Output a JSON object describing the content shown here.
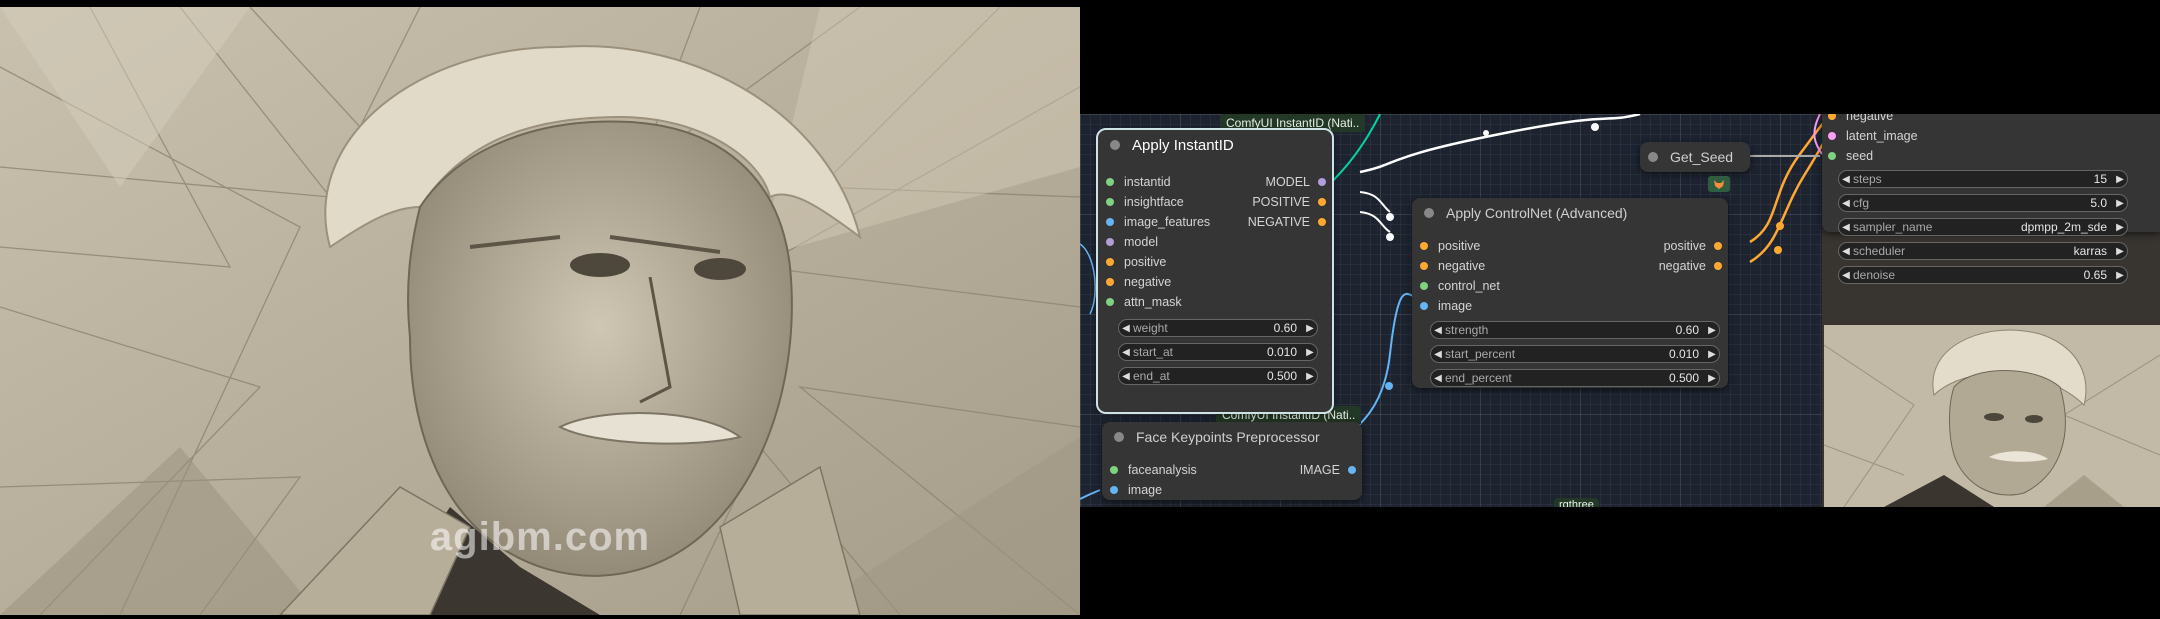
{
  "left_image": {
    "watermark": "agibm.com"
  },
  "canvas": {
    "group_tags": {
      "instantid_top": "ComfyUI InstantID (Nati..",
      "instantid_bottom": "ComfyUI InstantID (Nati..",
      "rgthree": "rgthree"
    },
    "apply_instantid": {
      "title": "Apply InstantID",
      "inputs": [
        "instantid",
        "insightface",
        "image_features",
        "model",
        "positive",
        "negative",
        "attn_mask"
      ],
      "outputs": [
        "MODEL",
        "POSITIVE",
        "NEGATIVE"
      ],
      "widgets": [
        {
          "label": "weight",
          "value": "0.60"
        },
        {
          "label": "start_at",
          "value": "0.010"
        },
        {
          "label": "end_at",
          "value": "0.500"
        }
      ]
    },
    "face_keypoints": {
      "title": "Face Keypoints Preprocessor",
      "inputs": [
        "faceanalysis",
        "image"
      ],
      "outputs": [
        "IMAGE"
      ]
    },
    "apply_controlnet": {
      "title": "Apply ControlNet (Advanced)",
      "inputs": [
        "positive",
        "negative",
        "control_net",
        "image"
      ],
      "outputs": [
        "positive",
        "negative"
      ],
      "widgets": [
        {
          "label": "strength",
          "value": "0.60"
        },
        {
          "label": "start_percent",
          "value": "0.010"
        },
        {
          "label": "end_percent",
          "value": "0.500"
        }
      ]
    },
    "get_seed": {
      "title": "Get_Seed"
    },
    "ksampler": {
      "inputs": [
        "negative",
        "latent_image",
        "seed"
      ],
      "widgets": [
        {
          "label": "steps",
          "value": "15"
        },
        {
          "label": "cfg",
          "value": "5.0"
        },
        {
          "label": "sampler_name",
          "value": "dpmpp_2m_sde"
        },
        {
          "label": "scheduler",
          "value": "karras"
        },
        {
          "label": "denoise",
          "value": "0.65"
        }
      ]
    }
  },
  "colors": {
    "model_pin": "#b39ddb",
    "conditioning_pin": "#ffa931",
    "image_pin": "#64b5f6",
    "generic_pin": "#7ed47e",
    "latent_pin": "#ff9cf9",
    "wire_model": "#ffffff",
    "wire_cond": "#ffa931",
    "wire_image": "#64b5f6",
    "wire_controlnet": "#00d6a3"
  },
  "icons": {
    "badge": "fox-icon",
    "arrow_left": "triangle-left-icon",
    "arrow_right": "triangle-right-icon"
  }
}
